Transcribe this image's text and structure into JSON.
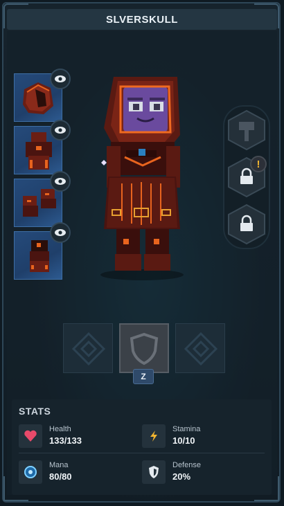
{
  "header": {
    "title": "SLVERSKULL"
  },
  "equipment": [
    {
      "slot": "hood",
      "visible_icon": "eye-icon"
    },
    {
      "slot": "chest",
      "visible_icon": "eye-icon"
    },
    {
      "slot": "boots",
      "visible_icon": "eye-icon"
    },
    {
      "slot": "legs",
      "visible_icon": "eye-icon"
    }
  ],
  "abilities": [
    {
      "name": "hammer-ability",
      "state": "available"
    },
    {
      "name": "locked-ability-1",
      "state": "locked",
      "alert": "!"
    },
    {
      "name": "locked-ability-2",
      "state": "locked"
    }
  ],
  "artifacts": {
    "selected_key": "Z"
  },
  "stats": {
    "title": "STATS",
    "health": {
      "label": "Health",
      "value": "133/133"
    },
    "stamina": {
      "label": "Stamina",
      "value": "10/10"
    },
    "mana": {
      "label": "Mana",
      "value": "80/80"
    },
    "defense": {
      "label": "Defense",
      "value": "20%"
    }
  },
  "colors": {
    "background": "#0f1a22",
    "panel": "#16232c",
    "slot_blue": "#254a7a",
    "accent_orange": "#e8641e",
    "warning_yellow": "#f2b530",
    "heart_red": "#e84a6a",
    "mana_blue": "#3aa0e0"
  }
}
